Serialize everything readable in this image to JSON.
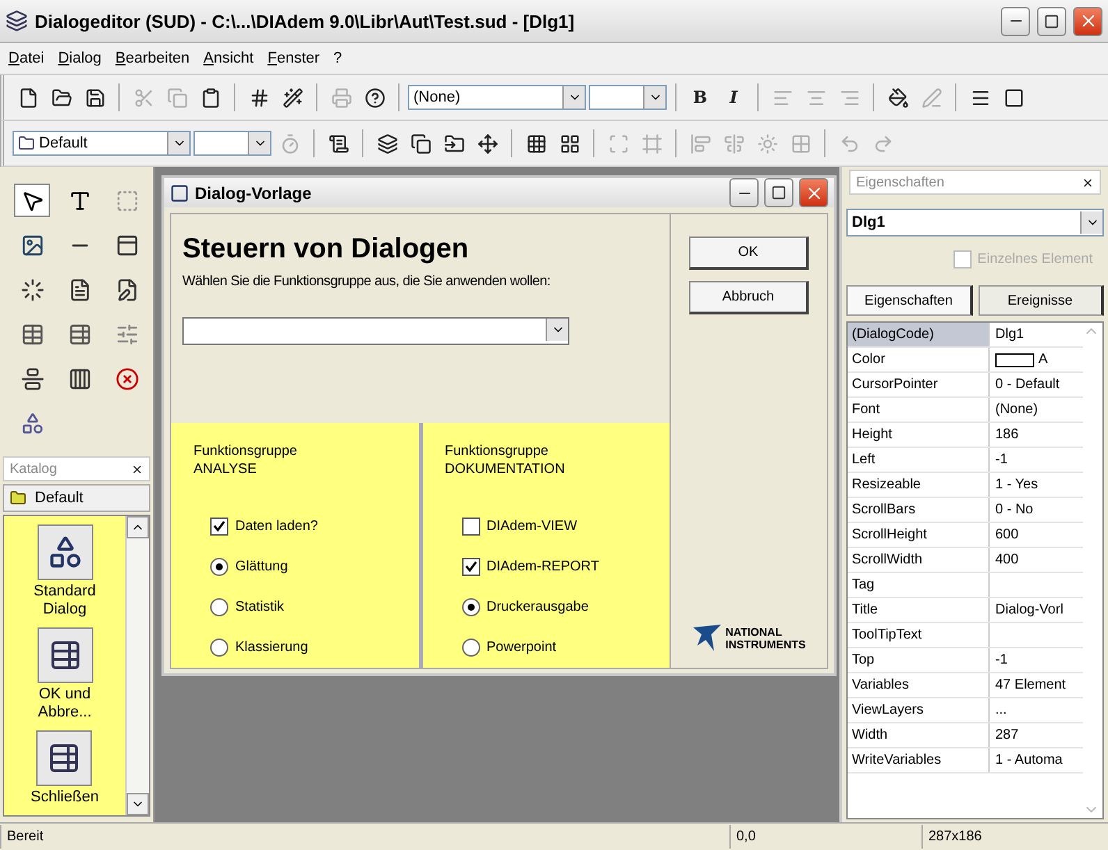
{
  "window": {
    "title": "Dialogeditor (SUD) - C:\\...\\DIAdem 9.0\\Libr\\Aut\\Test.sud - [Dlg1]"
  },
  "menu": [
    "Datei",
    "Dialog",
    "Bearbeiten",
    "Ansicht",
    "Fenster",
    "?"
  ],
  "toolbar_1": [
    {
      "kind": "icon",
      "disabled": false
    },
    {
      "kind": "icon",
      "disabled": false
    },
    {
      "kind": "icon",
      "disabled": false
    },
    {
      "kind": "sep"
    },
    {
      "kind": "icon",
      "disabled": true
    },
    {
      "kind": "icon",
      "disabled": true
    },
    {
      "kind": "icon",
      "disabled": false
    },
    {
      "kind": "sep"
    },
    {
      "kind": "icon",
      "disabled": false
    },
    {
      "kind": "icon",
      "disabled": false
    },
    {
      "kind": "sep"
    },
    {
      "kind": "icon",
      "disabled": true
    },
    {
      "kind": "icon",
      "disabled": false
    },
    {
      "kind": "sep"
    },
    {
      "kind": "combo",
      "value": "(None)",
      "wide": true
    },
    {
      "kind": "combo",
      "wide": false
    },
    {
      "kind": "sep"
    },
    {
      "kind": "text",
      "label": "B",
      "disabled": false
    },
    {
      "kind": "text",
      "label": "I",
      "disabled": false
    },
    {
      "kind": "sep"
    },
    {
      "kind": "icon",
      "disabled": true
    },
    {
      "kind": "icon",
      "disabled": true
    },
    {
      "kind": "icon",
      "disabled": true
    },
    {
      "kind": "sep"
    },
    {
      "kind": "icon",
      "disabled": false
    },
    {
      "kind": "icon",
      "disabled": true
    },
    {
      "kind": "sep"
    },
    {
      "kind": "icon",
      "disabled": false
    },
    {
      "kind": "icon",
      "disabled": false
    }
  ],
  "toolbar_2": [
    {
      "kind": "combo",
      "value": "Default",
      "wide": true
    },
    {
      "kind": "combo",
      "wide": false
    },
    {
      "kind": "icon",
      "disabled": true
    },
    {
      "kind": "sep"
    },
    {
      "kind": "icon",
      "disabled": false
    },
    {
      "kind": "sep"
    },
    {
      "kind": "icon",
      "disabled": false
    },
    {
      "kind": "icon",
      "disabled": false
    },
    {
      "kind": "icon",
      "disabled": false
    },
    {
      "kind": "icon",
      "disabled": false
    },
    {
      "kind": "sep"
    },
    {
      "kind": "icon",
      "disabled": false
    },
    {
      "kind": "icon",
      "disabled": false
    },
    {
      "kind": "sep"
    },
    {
      "kind": "icon",
      "disabled": true
    },
    {
      "kind": "icon",
      "disabled": true
    },
    {
      "kind": "sep"
    },
    {
      "kind": "icon",
      "disabled": true
    },
    {
      "kind": "icon",
      "disabled": true
    },
    {
      "kind": "icon",
      "disabled": true
    },
    {
      "kind": "icon",
      "disabled": true
    },
    {
      "kind": "sep"
    },
    {
      "kind": "icon",
      "disabled": true
    },
    {
      "kind": "icon",
      "disabled": true
    }
  ],
  "toolbox": {
    "tools": [
      {
        "selected": true
      },
      {
        "selected": false
      },
      {
        "selected": false
      },
      {
        "selected": false
      },
      {
        "selected": false
      },
      {
        "selected": false
      },
      {
        "selected": false
      },
      {
        "selected": false
      },
      {
        "selected": false
      },
      {
        "selected": false
      },
      {
        "selected": false
      },
      {
        "selected": false
      },
      {
        "selected": false
      },
      {
        "selected": false
      },
      {
        "selected": false
      },
      {
        "selected": false
      }
    ]
  },
  "catalog": {
    "title": "Katalog",
    "folder": "Default",
    "items": [
      {
        "label": "Standard\nDialog",
        "kind": "logo"
      },
      {
        "label": "OK und\nAbbre...",
        "kind": "buttons"
      },
      {
        "label": "Schließen",
        "kind": "buttons"
      }
    ]
  },
  "dialog": {
    "title": "Dialog-Vorlage",
    "heading": "Steuern von Dialogen",
    "instruction": "Wählen Sie die Funktionsgruppe aus, die Sie anwenden wollen:",
    "buttons": [
      "OK",
      "Abbruch"
    ],
    "groups": [
      {
        "title": "Funktionsgruppe\nANALYSE",
        "items": [
          {
            "kind": "checkbox",
            "label": "Daten laden?",
            "checked": true
          },
          {
            "kind": "radio",
            "label": "Glättung",
            "selected": true
          },
          {
            "kind": "radio",
            "label": "Statistik",
            "selected": false
          },
          {
            "kind": "radio",
            "label": "Klassierung",
            "selected": false
          }
        ]
      },
      {
        "title": "Funktionsgruppe\nDOKUMENTATION",
        "items": [
          {
            "kind": "checkbox",
            "label": "DIAdem-VIEW",
            "checked": false
          },
          {
            "kind": "checkbox",
            "label": "DIAdem-REPORT",
            "checked": true
          },
          {
            "kind": "radio",
            "label": "Druckerausgabe",
            "selected": true
          },
          {
            "kind": "radio",
            "label": "Powerpoint",
            "selected": false
          }
        ]
      }
    ],
    "logo": [
      "NATIONAL",
      "INSTRUMENTS"
    ]
  },
  "properties": {
    "title": "Eigenschaften",
    "object": "Dlg1",
    "single_element": {
      "label": "Einzelnes Element",
      "checked": false,
      "disabled": true
    },
    "tabs": [
      {
        "label": "Eigenschaften",
        "selected": true
      },
      {
        "label": "Ereignisse",
        "selected": false
      }
    ],
    "rows": [
      {
        "name": "(DialogCode)",
        "value": "Dlg1",
        "selected": true
      },
      {
        "name": "Color",
        "value": "A",
        "swatch": true,
        "selected": false
      },
      {
        "name": "CursorPointer",
        "value": "0 - Default",
        "selected": false
      },
      {
        "name": "Font",
        "value": "(None)",
        "selected": false
      },
      {
        "name": "Height",
        "value": "186",
        "selected": false
      },
      {
        "name": "Left",
        "value": "-1",
        "selected": false
      },
      {
        "name": "Resizeable",
        "value": "1 - Yes",
        "selected": false
      },
      {
        "name": "ScrollBars",
        "value": "0 - No",
        "selected": false
      },
      {
        "name": "ScrollHeight",
        "value": "600",
        "selected": false
      },
      {
        "name": "ScrollWidth",
        "value": "400",
        "selected": false
      },
      {
        "name": "Tag",
        "selected": false
      },
      {
        "name": "Title",
        "value": "Dialog-Vorl",
        "selected": false
      },
      {
        "name": "ToolTipText",
        "selected": false
      },
      {
        "name": "Top",
        "value": "-1",
        "selected": false
      },
      {
        "name": "Variables",
        "value": "47 Element",
        "selected": false
      },
      {
        "name": "ViewLayers",
        "value": "...",
        "selected": false
      },
      {
        "name": "Width",
        "value": "287",
        "selected": false
      },
      {
        "name": "WriteVariables",
        "value": "1 - Automa",
        "selected": false
      }
    ]
  },
  "status_bar": [
    "Bereit",
    "0,0",
    "287x186"
  ]
}
